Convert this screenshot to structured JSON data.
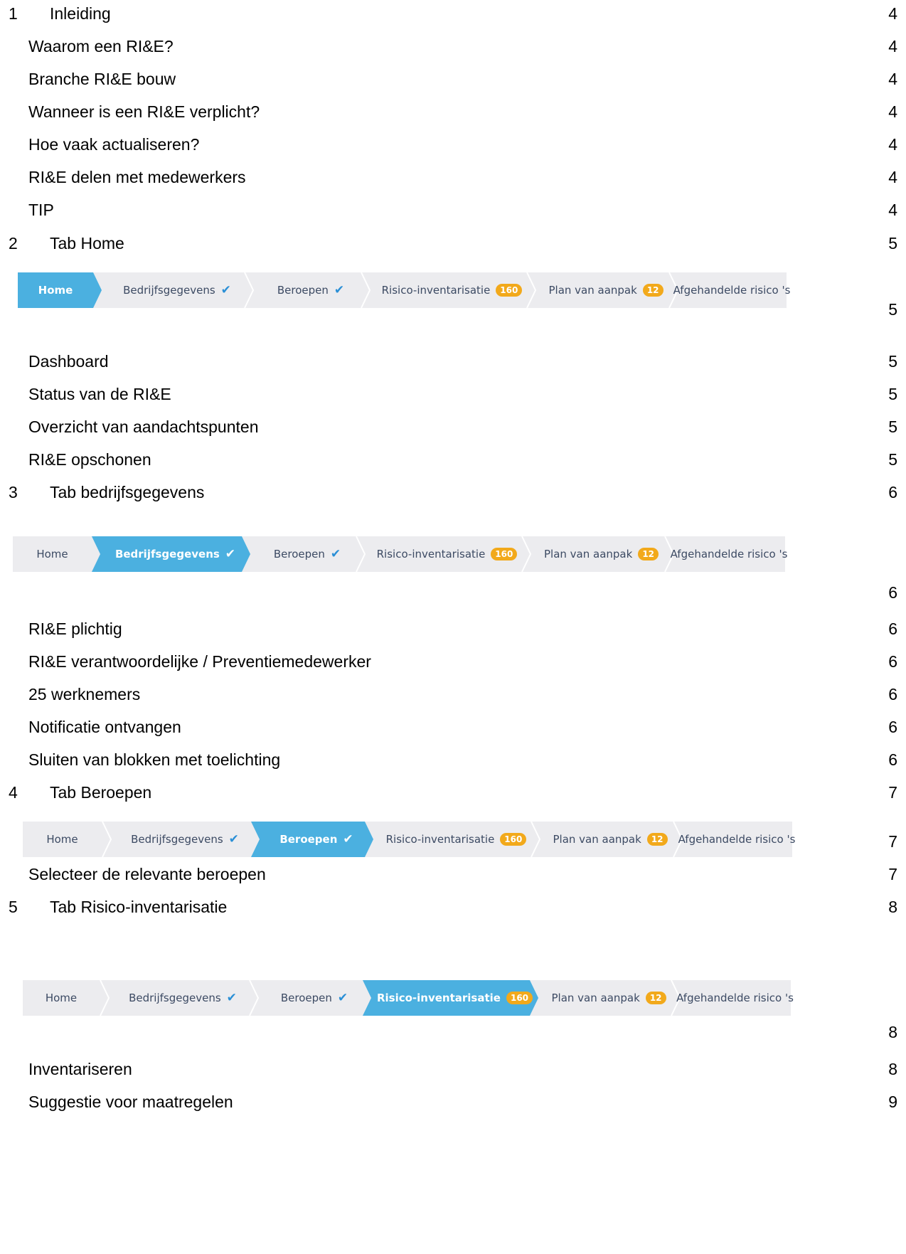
{
  "toc": [
    {
      "number": "1",
      "title": "Inleiding",
      "page": "4"
    },
    {
      "title": "Waarom een RI&E?",
      "page": "4"
    },
    {
      "title": "Branche RI&E bouw",
      "page": "4"
    },
    {
      "title": "Wanneer is een RI&E verplicht?",
      "page": "4"
    },
    {
      "title": "Hoe vaak actualiseren?",
      "page": "4"
    },
    {
      "title": "RI&E delen met medewerkers",
      "page": "4"
    },
    {
      "title": "TIP",
      "page": "4"
    },
    {
      "number": "2",
      "title": "Tab Home",
      "page": "5"
    },
    {
      "page": "5"
    },
    {
      "title": "Dashboard",
      "page": "5"
    },
    {
      "title": "Status van de RI&E",
      "page": "5"
    },
    {
      "title": "Overzicht van aandachtspunten",
      "page": "5"
    },
    {
      "title": "RI&E opschonen",
      "page": "5"
    },
    {
      "number": "3",
      "title": "Tab bedrijfsgegevens",
      "page": "6"
    },
    {
      "page": "6"
    },
    {
      "title": "RI&E plichtig",
      "page": "6"
    },
    {
      "title": "RI&E verantwoordelijke / Preventiemedewerker",
      "page": "6"
    },
    {
      "title": "25 werknemers",
      "page": "6"
    },
    {
      "title": "Notificatie ontvangen",
      "page": "6"
    },
    {
      "title": "Sluiten van blokken met toelichting",
      "page": "6"
    },
    {
      "number": "4",
      "title": "Tab Beroepen",
      "page": "7"
    },
    {
      "page": "7"
    },
    {
      "title": "Selecteer de relevante beroepen",
      "page": "7"
    },
    {
      "number": "5",
      "title": "Tab Risico-inventarisatie",
      "page": "8"
    },
    {
      "page": "8"
    },
    {
      "title": "Inventariseren",
      "page": "8"
    },
    {
      "title": "Suggestie voor maatregelen",
      "page": "9"
    }
  ],
  "nav_tabs": [
    {
      "label": "Home"
    },
    {
      "label": "Bedrijfsgegevens",
      "icon": "check-icon"
    },
    {
      "label": "Beroepen",
      "icon": "check-icon"
    },
    {
      "label": "Risico-inventarisatie",
      "badge": "160"
    },
    {
      "label": "Plan van aanpak",
      "badge": "12"
    },
    {
      "label": "Afgehandelde risico 's"
    }
  ],
  "breadcrumbs": [
    {
      "active_index": 0
    },
    {
      "active_index": 1
    },
    {
      "active_index": 2
    },
    {
      "active_index": 3
    }
  ],
  "colors": {
    "bar_background": "#ececef",
    "active_tab": "#4bb0e0",
    "check": "#2a8fd6",
    "badge": "#f2a91b",
    "tab_text": "#3c4a63"
  }
}
